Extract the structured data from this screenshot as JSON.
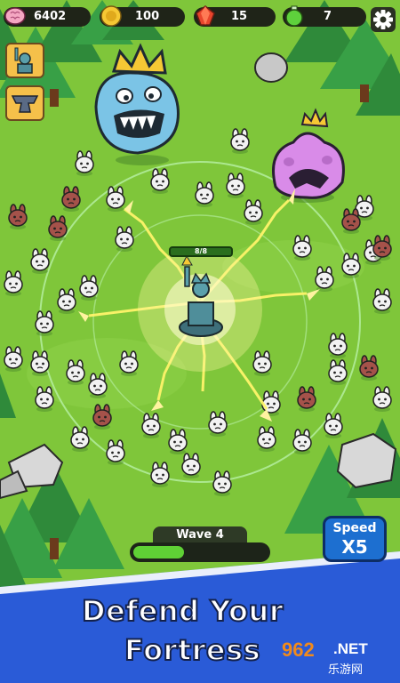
{
  "hud": {
    "brains": "6402",
    "coins": "100",
    "gems": "15",
    "potions": "7"
  },
  "tower": {
    "hp": "8/8"
  },
  "wave": {
    "label": "Wave 4",
    "progress": 0.38
  },
  "speed": {
    "label": "Speed",
    "multiplier": "X5"
  },
  "banner": {
    "line1": "Defend Your",
    "line2": "Fortress"
  },
  "watermark": {
    "num": "962",
    "net": ".NET",
    "sub": "乐游网"
  },
  "colors": {
    "grass": "#7fc63a",
    "banner": "#2a5bd7",
    "accent": "#f5c04a"
  },
  "icons": [
    "brain-icon",
    "coin-icon",
    "gem-icon",
    "potion-icon",
    "gear-icon",
    "statue-icon",
    "anvil-icon"
  ]
}
